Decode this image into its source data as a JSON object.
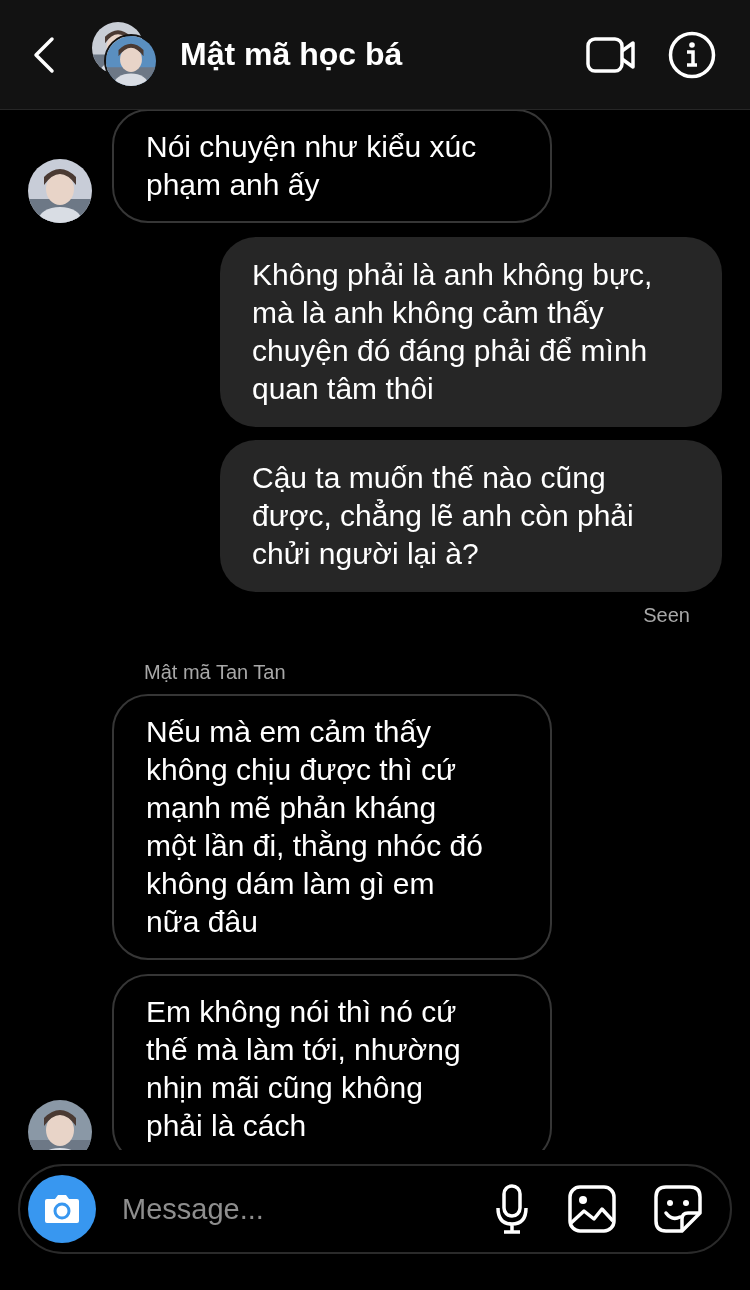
{
  "header": {
    "title": "Mật mã học bá"
  },
  "messages": [
    {
      "kind": "received",
      "avatar": true,
      "text": "Nói chuyện như kiểu xúc phạm anh ấy"
    },
    {
      "kind": "sent",
      "text": "Không phải là anh không bực, mà là anh không cảm thấy chuyện đó đáng phải để mình quan tâm thôi"
    },
    {
      "kind": "sent",
      "text": "Cậu ta muốn thế nào cũng được, chẳng lẽ anh còn phải chửi người lại à?"
    },
    {
      "kind": "status",
      "text": "Seen"
    },
    {
      "kind": "sender",
      "text": "Mật mã Tan Tan"
    },
    {
      "kind": "received",
      "avatar": false,
      "text": "Nếu mà em cảm thấy không chịu được thì cứ mạnh mẽ phản kháng một lần đi, thằng nhóc đó không dám làm gì em nữa đâu"
    },
    {
      "kind": "received",
      "avatar": true,
      "text": "Em không nói thì nó cứ thế mà làm tới, nhường nhịn mãi cũng không phải là cách"
    }
  ],
  "composer": {
    "placeholder": "Message..."
  }
}
